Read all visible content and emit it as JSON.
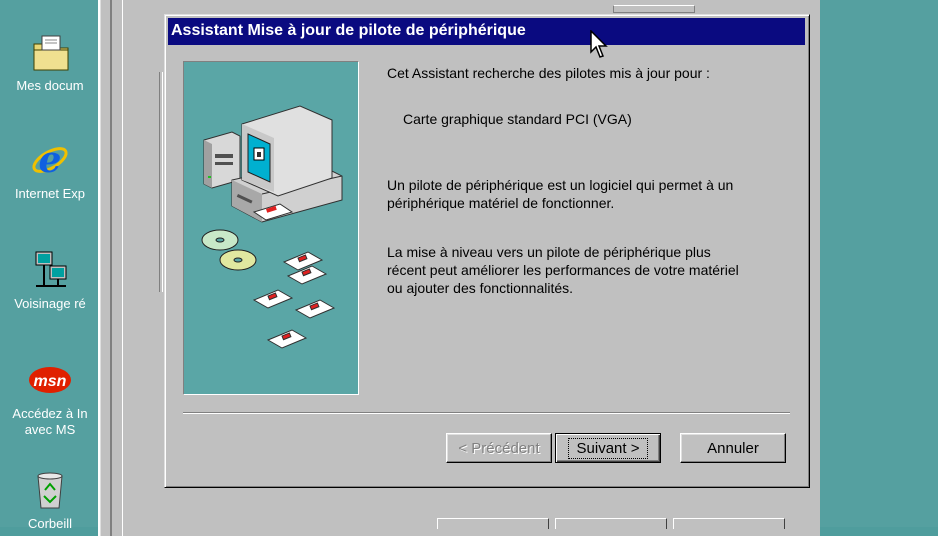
{
  "desktop": {
    "icons": [
      {
        "label": "Mes docum"
      },
      {
        "label": "Internet Exp"
      },
      {
        "label": "Voisinage ré"
      },
      {
        "label": "Accédez à In",
        "label2": "avec MS"
      },
      {
        "label": "Corbeill"
      }
    ]
  },
  "dialog": {
    "title": "Assistant Mise à jour de pilote de périphérique",
    "intro": "Cet Assistant recherche des pilotes mis à jour pour :",
    "device": "Carte graphique standard PCI (VGA)",
    "para1_line1": "Un pilote de périphérique est un logiciel qui permet à un",
    "para1_line2": "périphérique matériel de fonctionner.",
    "para2_line1": "La mise à niveau vers un pilote de périphérique plus",
    "para2_line2": "récent peut améliorer les performances de votre matériel",
    "para2_line3": "ou ajouter des fonctionnalités.",
    "buttons": {
      "back": "< Précédent",
      "next": "Suivant >",
      "cancel": "Annuler"
    }
  },
  "colors": {
    "desktop": "#55a0a0",
    "titlebar": "#0a0a80",
    "face": "#c0c0c0"
  },
  "icons": [
    "my-documents-icon",
    "internet-explorer-icon",
    "network-neighborhood-icon",
    "msn-icon",
    "recycle-bin-icon",
    "computer-illustration",
    "mouse-cursor-icon"
  ]
}
